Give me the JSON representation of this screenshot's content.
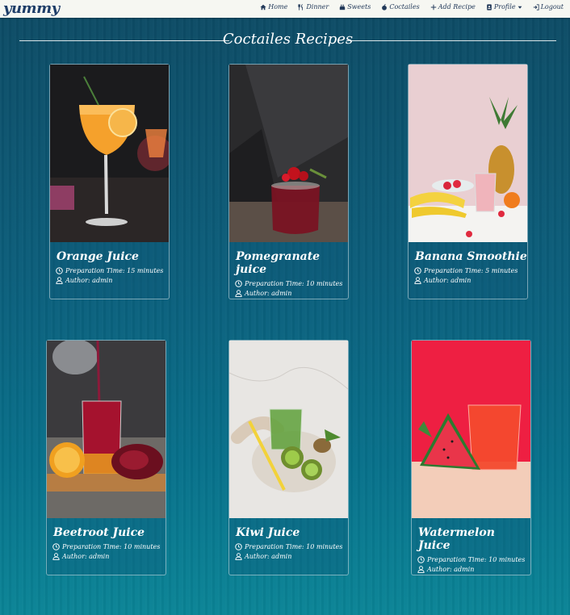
{
  "brand": "yummy",
  "nav": [
    {
      "label": "Home",
      "icon": "home-icon"
    },
    {
      "label": "Dinner",
      "icon": "utensils-icon"
    },
    {
      "label": "Sweets",
      "icon": "cake-icon"
    },
    {
      "label": "Coctailes",
      "icon": "apple-icon"
    },
    {
      "label": "Add Recipe",
      "icon": "plus-icon"
    },
    {
      "label": "Profile",
      "icon": "id-badge-icon"
    },
    {
      "label": "Logout",
      "icon": "logout-icon"
    }
  ],
  "page_title": "Coctailes Recipes",
  "recipes": [
    {
      "name": "Orange Juice",
      "prep": "Preparation Time: 15 minutes",
      "author": "Author: admin",
      "image": "orange-juice-photo"
    },
    {
      "name": "Pomegranate juice",
      "prep": "Preparation Time: 10 minutes",
      "author": "Author: admin",
      "image": "pomegranate-juice-photo"
    },
    {
      "name": "Banana Smoothie",
      "prep": "Preparation Time: 5 minutes",
      "author": "Author: admin",
      "image": "banana-smoothie-photo"
    },
    {
      "name": "Beetroot Juice",
      "prep": "Preparation Time: 10 minutes",
      "author": "Author: admin",
      "image": "beetroot-juice-photo"
    },
    {
      "name": "Kiwi Juice",
      "prep": "Preparation Time: 10 minutes",
      "author": "Author: admin",
      "image": "kiwi-juice-photo"
    },
    {
      "name": "Watermelon Juice",
      "prep": "Preparation Time: 10 minutes",
      "author": "Author: admin",
      "image": "watermelon-juice-photo"
    }
  ]
}
